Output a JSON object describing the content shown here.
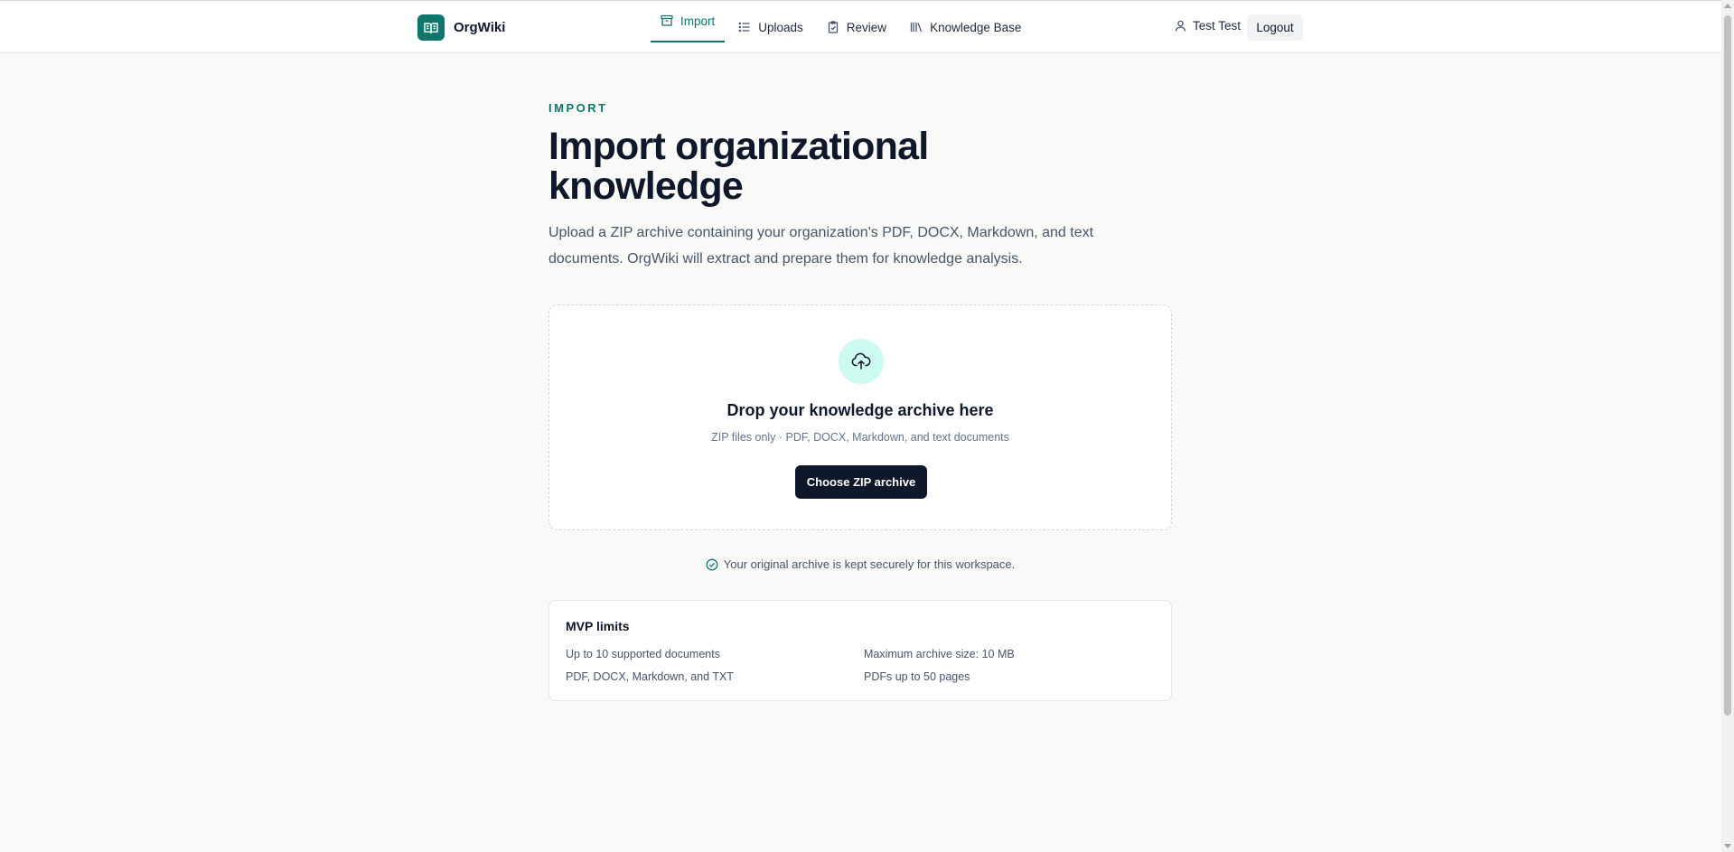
{
  "header": {
    "brand_name": "OrgWiki",
    "nav": [
      {
        "label": "Import",
        "icon": "archive-icon",
        "active": true
      },
      {
        "label": "Uploads",
        "icon": "list-icon",
        "active": false
      },
      {
        "label": "Review",
        "icon": "clipboard-check-icon",
        "active": false
      },
      {
        "label": "Knowledge Base",
        "icon": "library-icon",
        "active": false
      }
    ],
    "user_name": "Test Test",
    "logout_label": "Logout"
  },
  "page": {
    "eyebrow": "IMPORT",
    "title": "Import organizational knowledge",
    "description": "Upload a ZIP archive containing your organization's PDF, DOCX, Markdown, and text documents. OrgWiki will extract and prepare them for knowledge analysis."
  },
  "dropzone": {
    "icon": "cloud-upload-icon",
    "title": "Drop your knowledge archive here",
    "subtitle": "ZIP files only · PDF, DOCX, Markdown, and text documents",
    "button_label": "Choose ZIP archive"
  },
  "secure_note": "Your original archive is kept securely for this workspace.",
  "limits": {
    "title": "MVP limits",
    "items": [
      "Up to 10 supported documents",
      "Maximum archive size: 10 MB",
      "PDF, DOCX, Markdown, and TXT",
      "PDFs up to 50 pages"
    ]
  },
  "colors": {
    "accent": "#0f766e",
    "dark_button": "#0f172a",
    "icon_circle": "#ccfbf1"
  }
}
